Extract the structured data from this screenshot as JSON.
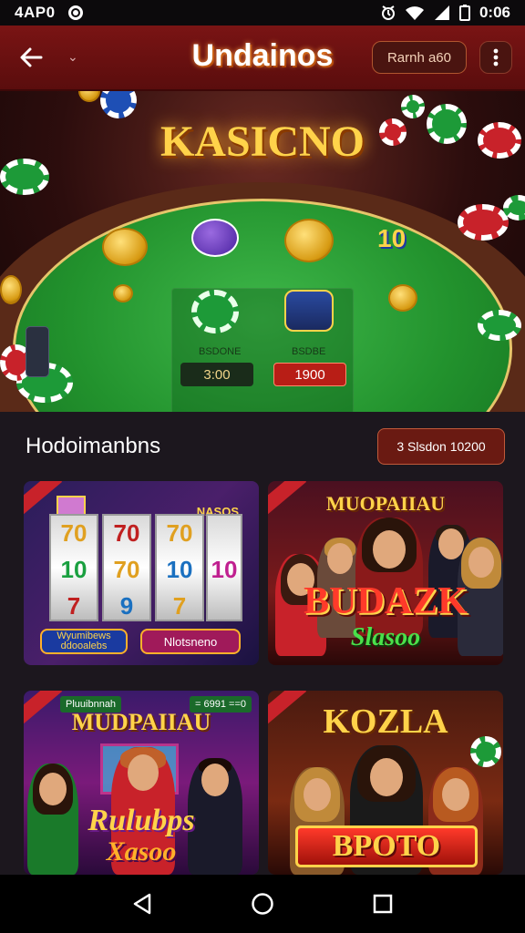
{
  "status_bar": {
    "time": "4AP0",
    "clock": "0:06"
  },
  "app_bar": {
    "title": "Undainos",
    "pill_label": "Rarnh a60"
  },
  "hero": {
    "logo": "KASICNO",
    "stake_left_label": "BSDONE",
    "stake_right_label": "BSDBE",
    "stake_left_value": "3:00",
    "stake_right_value": "1900",
    "badge_value": "10"
  },
  "section": {
    "title": "Hodoimanbns",
    "pill_label": "3 Slsdon 10200"
  },
  "cards": [
    {
      "reels": [
        [
          "70",
          "10",
          "7"
        ],
        [
          "70",
          "70",
          "9"
        ],
        [
          "70",
          "10",
          "7"
        ]
      ],
      "header_sign": "NASOS",
      "button_left": "Wyumibews ddooalebs",
      "button_right": "Nlotsneno"
    },
    {
      "heading": "MUOPAIIAU",
      "title": "BUDAZK",
      "subtitle": "Slasoo"
    },
    {
      "tag_left": "Pluuibnnah",
      "tag_right": "= 6991 ==0",
      "heading": "MUDPAIIAU",
      "title": "Rulubps",
      "subtitle": "Xasoo"
    },
    {
      "heading": "KOZLA",
      "title": "BPOTO"
    }
  ],
  "colors": {
    "app_bar": "#7a1414",
    "felt": "#22922d",
    "gold": "#ffd34a",
    "accent_red": "#c8222a"
  }
}
